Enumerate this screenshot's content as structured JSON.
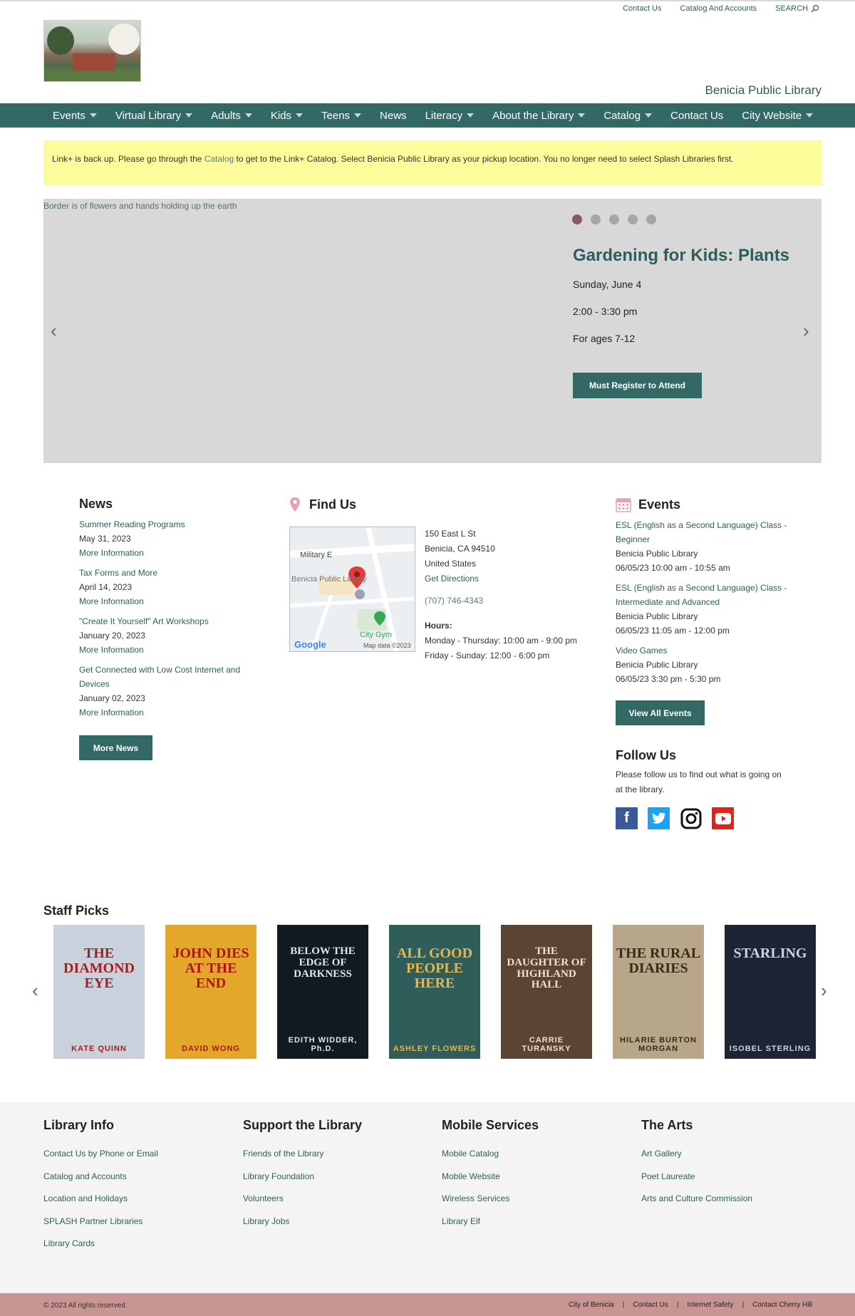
{
  "utility_links": [
    "Contact Us",
    "Catalog And Accounts"
  ],
  "search_label": "SEARCH",
  "site_name": "Benicia Public Library",
  "nav": [
    {
      "label": "Events",
      "dropdown": true
    },
    {
      "label": "Virtual Library",
      "dropdown": true
    },
    {
      "label": "Adults",
      "dropdown": true
    },
    {
      "label": "Kids",
      "dropdown": true
    },
    {
      "label": "Teens",
      "dropdown": true
    },
    {
      "label": "News",
      "dropdown": false
    },
    {
      "label": "Literacy",
      "dropdown": true
    },
    {
      "label": "About the Library",
      "dropdown": true
    },
    {
      "label": "Catalog",
      "dropdown": true
    },
    {
      "label": "Contact Us",
      "dropdown": false
    },
    {
      "label": "City Website",
      "dropdown": true
    }
  ],
  "alert": {
    "before": "Link+ is back up.  Please go through the ",
    "link": "Catalog",
    "after": " to get to the Link+ Catalog. Select Benicia Public Library as your pickup location.  You no longer need to select Splash Libraries first."
  },
  "slider": {
    "image_alt": "Border is of flowers and hands holding up the earth",
    "dots": 5,
    "active_dot": 1,
    "title": "Gardening for Kids: Plants",
    "date": "Sunday, June 4",
    "time": "2:00 - 3:30 pm",
    "ages": "For ages 7-12",
    "button": "Must Register to Attend",
    "prev": "‹",
    "next": "›"
  },
  "news": {
    "heading": "News",
    "items": [
      {
        "title": "Summer Reading Programs",
        "date": "May 31, 2023",
        "more": "More Information"
      },
      {
        "title": "Tax Forms and More",
        "date": "April 14, 2023",
        "more": "More Information"
      },
      {
        "title": "\"Create It Yourself\" Art Workshops",
        "date": "January 20, 2023",
        "more": "More Information"
      },
      {
        "title": "Get Connected with Low Cost Internet and Devices",
        "date": "January 02, 2023",
        "more": "More Information"
      }
    ],
    "button": "More News"
  },
  "find_us": {
    "heading": "Find Us",
    "map": {
      "street": "Military E",
      "place": "Benicia Public Library",
      "poi": "City Gym",
      "brand": "Google",
      "credit": "Map data ©2023"
    },
    "address": [
      "150 East L St",
      "Benicia, CA 94510",
      "United States"
    ],
    "directions": "Get Directions",
    "phone": "(707) 746-4343",
    "hours_label": "Hours:",
    "hours": [
      "Monday - Thursday: 10:00 am - 9:00 pm",
      "Friday - Sunday: 12:00 - 6:00 pm"
    ]
  },
  "events": {
    "heading": "Events",
    "items": [
      {
        "title": "ESL (English as a Second Language) Class - Beginner",
        "place": "Benicia Public Library",
        "when": "06/05/23 10:00 am - 10:55 am"
      },
      {
        "title": "ESL (English as a Second Language) Class - Intermediate and Advanced",
        "place": "Benicia Public Library",
        "when": "06/05/23 11:05 am - 12:00 pm"
      },
      {
        "title": "Video Games",
        "place": "Benicia Public Library",
        "when": "06/05/23 3:30 pm - 5:30 pm"
      }
    ],
    "button": "View All Events"
  },
  "follow": {
    "heading": "Follow Us",
    "text": "Please follow us to find out what is going on at the library.",
    "icons": [
      "facebook-icon",
      "twitter-icon",
      "instagram-icon",
      "youtube-icon"
    ]
  },
  "staff_picks": {
    "heading": "Staff Picks",
    "books": [
      {
        "title": "THE DIAMOND EYE",
        "author": "KATE QUINN",
        "bg": "#c9d2dc",
        "fg": "#a51f1f"
      },
      {
        "title": "JOHN DIES AT THE END",
        "author": "DAVID WONG",
        "bg": "#e3a72a",
        "fg": "#b0141a"
      },
      {
        "title": "BELOW THE EDGE OF DARKNESS",
        "author": "EDITH WIDDER, Ph.D.",
        "bg": "#0f1a22",
        "fg": "#dfe6ea"
      },
      {
        "title": "ALL GOOD PEOPLE HERE",
        "author": "ASHLEY FLOWERS",
        "bg": "#2f5e5a",
        "fg": "#e8b64a"
      },
      {
        "title": "THE DAUGHTER OF HIGHLAND HALL",
        "author": "CARRIE TURANSKY",
        "bg": "#5b4433",
        "fg": "#f0e3c8"
      },
      {
        "title": "THE RURAL DIARIES",
        "author": "HILARIE BURTON MORGAN",
        "bg": "#b8a688",
        "fg": "#3b2a1a"
      },
      {
        "title": "STARLING",
        "author": "ISOBEL STERLING",
        "bg": "#1d2433",
        "fg": "#c9d2e0"
      }
    ],
    "prev": "‹",
    "next": "›"
  },
  "footer": {
    "columns": [
      {
        "heading": "Library Info",
        "links": [
          "Contact Us by Phone or Email",
          "Catalog and Accounts",
          "Location and Holidays",
          "SPLASH Partner Libraries",
          "Library Cards"
        ]
      },
      {
        "heading": "Support the Library",
        "links": [
          "Friends of the Library",
          "Library Foundation",
          "Volunteers",
          "Library Jobs"
        ]
      },
      {
        "heading": "Mobile Services",
        "links": [
          "Mobile Catalog",
          "Mobile Website",
          "Wireless Services",
          "Library Elf"
        ]
      },
      {
        "heading": "The Arts",
        "links": [
          "Art Gallery",
          "Poet Laureate",
          "Arts and Culture Commission"
        ]
      }
    ],
    "copyright": "© 2023 All rights reserved.",
    "bottom_links": [
      "City of Benicia",
      "Contact Us",
      "Internet Safety",
      "Contact Cherry Hill"
    ]
  },
  "colors": {
    "primary": "#326965",
    "alert_bg": "#fcfc9b",
    "footer_bar": "#c99593"
  }
}
